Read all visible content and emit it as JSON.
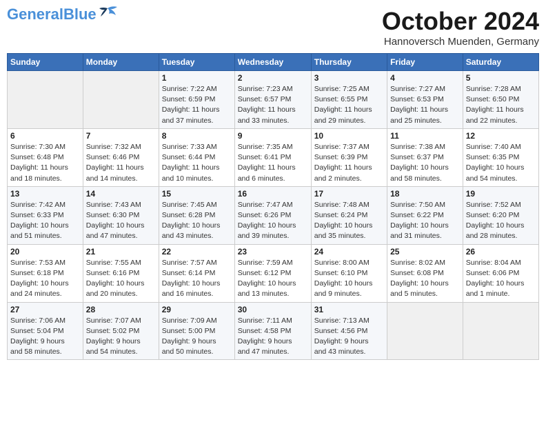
{
  "header": {
    "logo_general": "General",
    "logo_blue": "Blue",
    "month": "October 2024",
    "location": "Hannoversch Muenden, Germany"
  },
  "weekdays": [
    "Sunday",
    "Monday",
    "Tuesday",
    "Wednesday",
    "Thursday",
    "Friday",
    "Saturday"
  ],
  "weeks": [
    [
      {
        "day": "",
        "detail": ""
      },
      {
        "day": "",
        "detail": ""
      },
      {
        "day": "1",
        "detail": "Sunrise: 7:22 AM\nSunset: 6:59 PM\nDaylight: 11 hours\nand 37 minutes."
      },
      {
        "day": "2",
        "detail": "Sunrise: 7:23 AM\nSunset: 6:57 PM\nDaylight: 11 hours\nand 33 minutes."
      },
      {
        "day": "3",
        "detail": "Sunrise: 7:25 AM\nSunset: 6:55 PM\nDaylight: 11 hours\nand 29 minutes."
      },
      {
        "day": "4",
        "detail": "Sunrise: 7:27 AM\nSunset: 6:53 PM\nDaylight: 11 hours\nand 25 minutes."
      },
      {
        "day": "5",
        "detail": "Sunrise: 7:28 AM\nSunset: 6:50 PM\nDaylight: 11 hours\nand 22 minutes."
      }
    ],
    [
      {
        "day": "6",
        "detail": "Sunrise: 7:30 AM\nSunset: 6:48 PM\nDaylight: 11 hours\nand 18 minutes."
      },
      {
        "day": "7",
        "detail": "Sunrise: 7:32 AM\nSunset: 6:46 PM\nDaylight: 11 hours\nand 14 minutes."
      },
      {
        "day": "8",
        "detail": "Sunrise: 7:33 AM\nSunset: 6:44 PM\nDaylight: 11 hours\nand 10 minutes."
      },
      {
        "day": "9",
        "detail": "Sunrise: 7:35 AM\nSunset: 6:41 PM\nDaylight: 11 hours\nand 6 minutes."
      },
      {
        "day": "10",
        "detail": "Sunrise: 7:37 AM\nSunset: 6:39 PM\nDaylight: 11 hours\nand 2 minutes."
      },
      {
        "day": "11",
        "detail": "Sunrise: 7:38 AM\nSunset: 6:37 PM\nDaylight: 10 hours\nand 58 minutes."
      },
      {
        "day": "12",
        "detail": "Sunrise: 7:40 AM\nSunset: 6:35 PM\nDaylight: 10 hours\nand 54 minutes."
      }
    ],
    [
      {
        "day": "13",
        "detail": "Sunrise: 7:42 AM\nSunset: 6:33 PM\nDaylight: 10 hours\nand 51 minutes."
      },
      {
        "day": "14",
        "detail": "Sunrise: 7:43 AM\nSunset: 6:30 PM\nDaylight: 10 hours\nand 47 minutes."
      },
      {
        "day": "15",
        "detail": "Sunrise: 7:45 AM\nSunset: 6:28 PM\nDaylight: 10 hours\nand 43 minutes."
      },
      {
        "day": "16",
        "detail": "Sunrise: 7:47 AM\nSunset: 6:26 PM\nDaylight: 10 hours\nand 39 minutes."
      },
      {
        "day": "17",
        "detail": "Sunrise: 7:48 AM\nSunset: 6:24 PM\nDaylight: 10 hours\nand 35 minutes."
      },
      {
        "day": "18",
        "detail": "Sunrise: 7:50 AM\nSunset: 6:22 PM\nDaylight: 10 hours\nand 31 minutes."
      },
      {
        "day": "19",
        "detail": "Sunrise: 7:52 AM\nSunset: 6:20 PM\nDaylight: 10 hours\nand 28 minutes."
      }
    ],
    [
      {
        "day": "20",
        "detail": "Sunrise: 7:53 AM\nSunset: 6:18 PM\nDaylight: 10 hours\nand 24 minutes."
      },
      {
        "day": "21",
        "detail": "Sunrise: 7:55 AM\nSunset: 6:16 PM\nDaylight: 10 hours\nand 20 minutes."
      },
      {
        "day": "22",
        "detail": "Sunrise: 7:57 AM\nSunset: 6:14 PM\nDaylight: 10 hours\nand 16 minutes."
      },
      {
        "day": "23",
        "detail": "Sunrise: 7:59 AM\nSunset: 6:12 PM\nDaylight: 10 hours\nand 13 minutes."
      },
      {
        "day": "24",
        "detail": "Sunrise: 8:00 AM\nSunset: 6:10 PM\nDaylight: 10 hours\nand 9 minutes."
      },
      {
        "day": "25",
        "detail": "Sunrise: 8:02 AM\nSunset: 6:08 PM\nDaylight: 10 hours\nand 5 minutes."
      },
      {
        "day": "26",
        "detail": "Sunrise: 8:04 AM\nSunset: 6:06 PM\nDaylight: 10 hours\nand 1 minute."
      }
    ],
    [
      {
        "day": "27",
        "detail": "Sunrise: 7:06 AM\nSunset: 5:04 PM\nDaylight: 9 hours\nand 58 minutes."
      },
      {
        "day": "28",
        "detail": "Sunrise: 7:07 AM\nSunset: 5:02 PM\nDaylight: 9 hours\nand 54 minutes."
      },
      {
        "day": "29",
        "detail": "Sunrise: 7:09 AM\nSunset: 5:00 PM\nDaylight: 9 hours\nand 50 minutes."
      },
      {
        "day": "30",
        "detail": "Sunrise: 7:11 AM\nSunset: 4:58 PM\nDaylight: 9 hours\nand 47 minutes."
      },
      {
        "day": "31",
        "detail": "Sunrise: 7:13 AM\nSunset: 4:56 PM\nDaylight: 9 hours\nand 43 minutes."
      },
      {
        "day": "",
        "detail": ""
      },
      {
        "day": "",
        "detail": ""
      }
    ]
  ]
}
